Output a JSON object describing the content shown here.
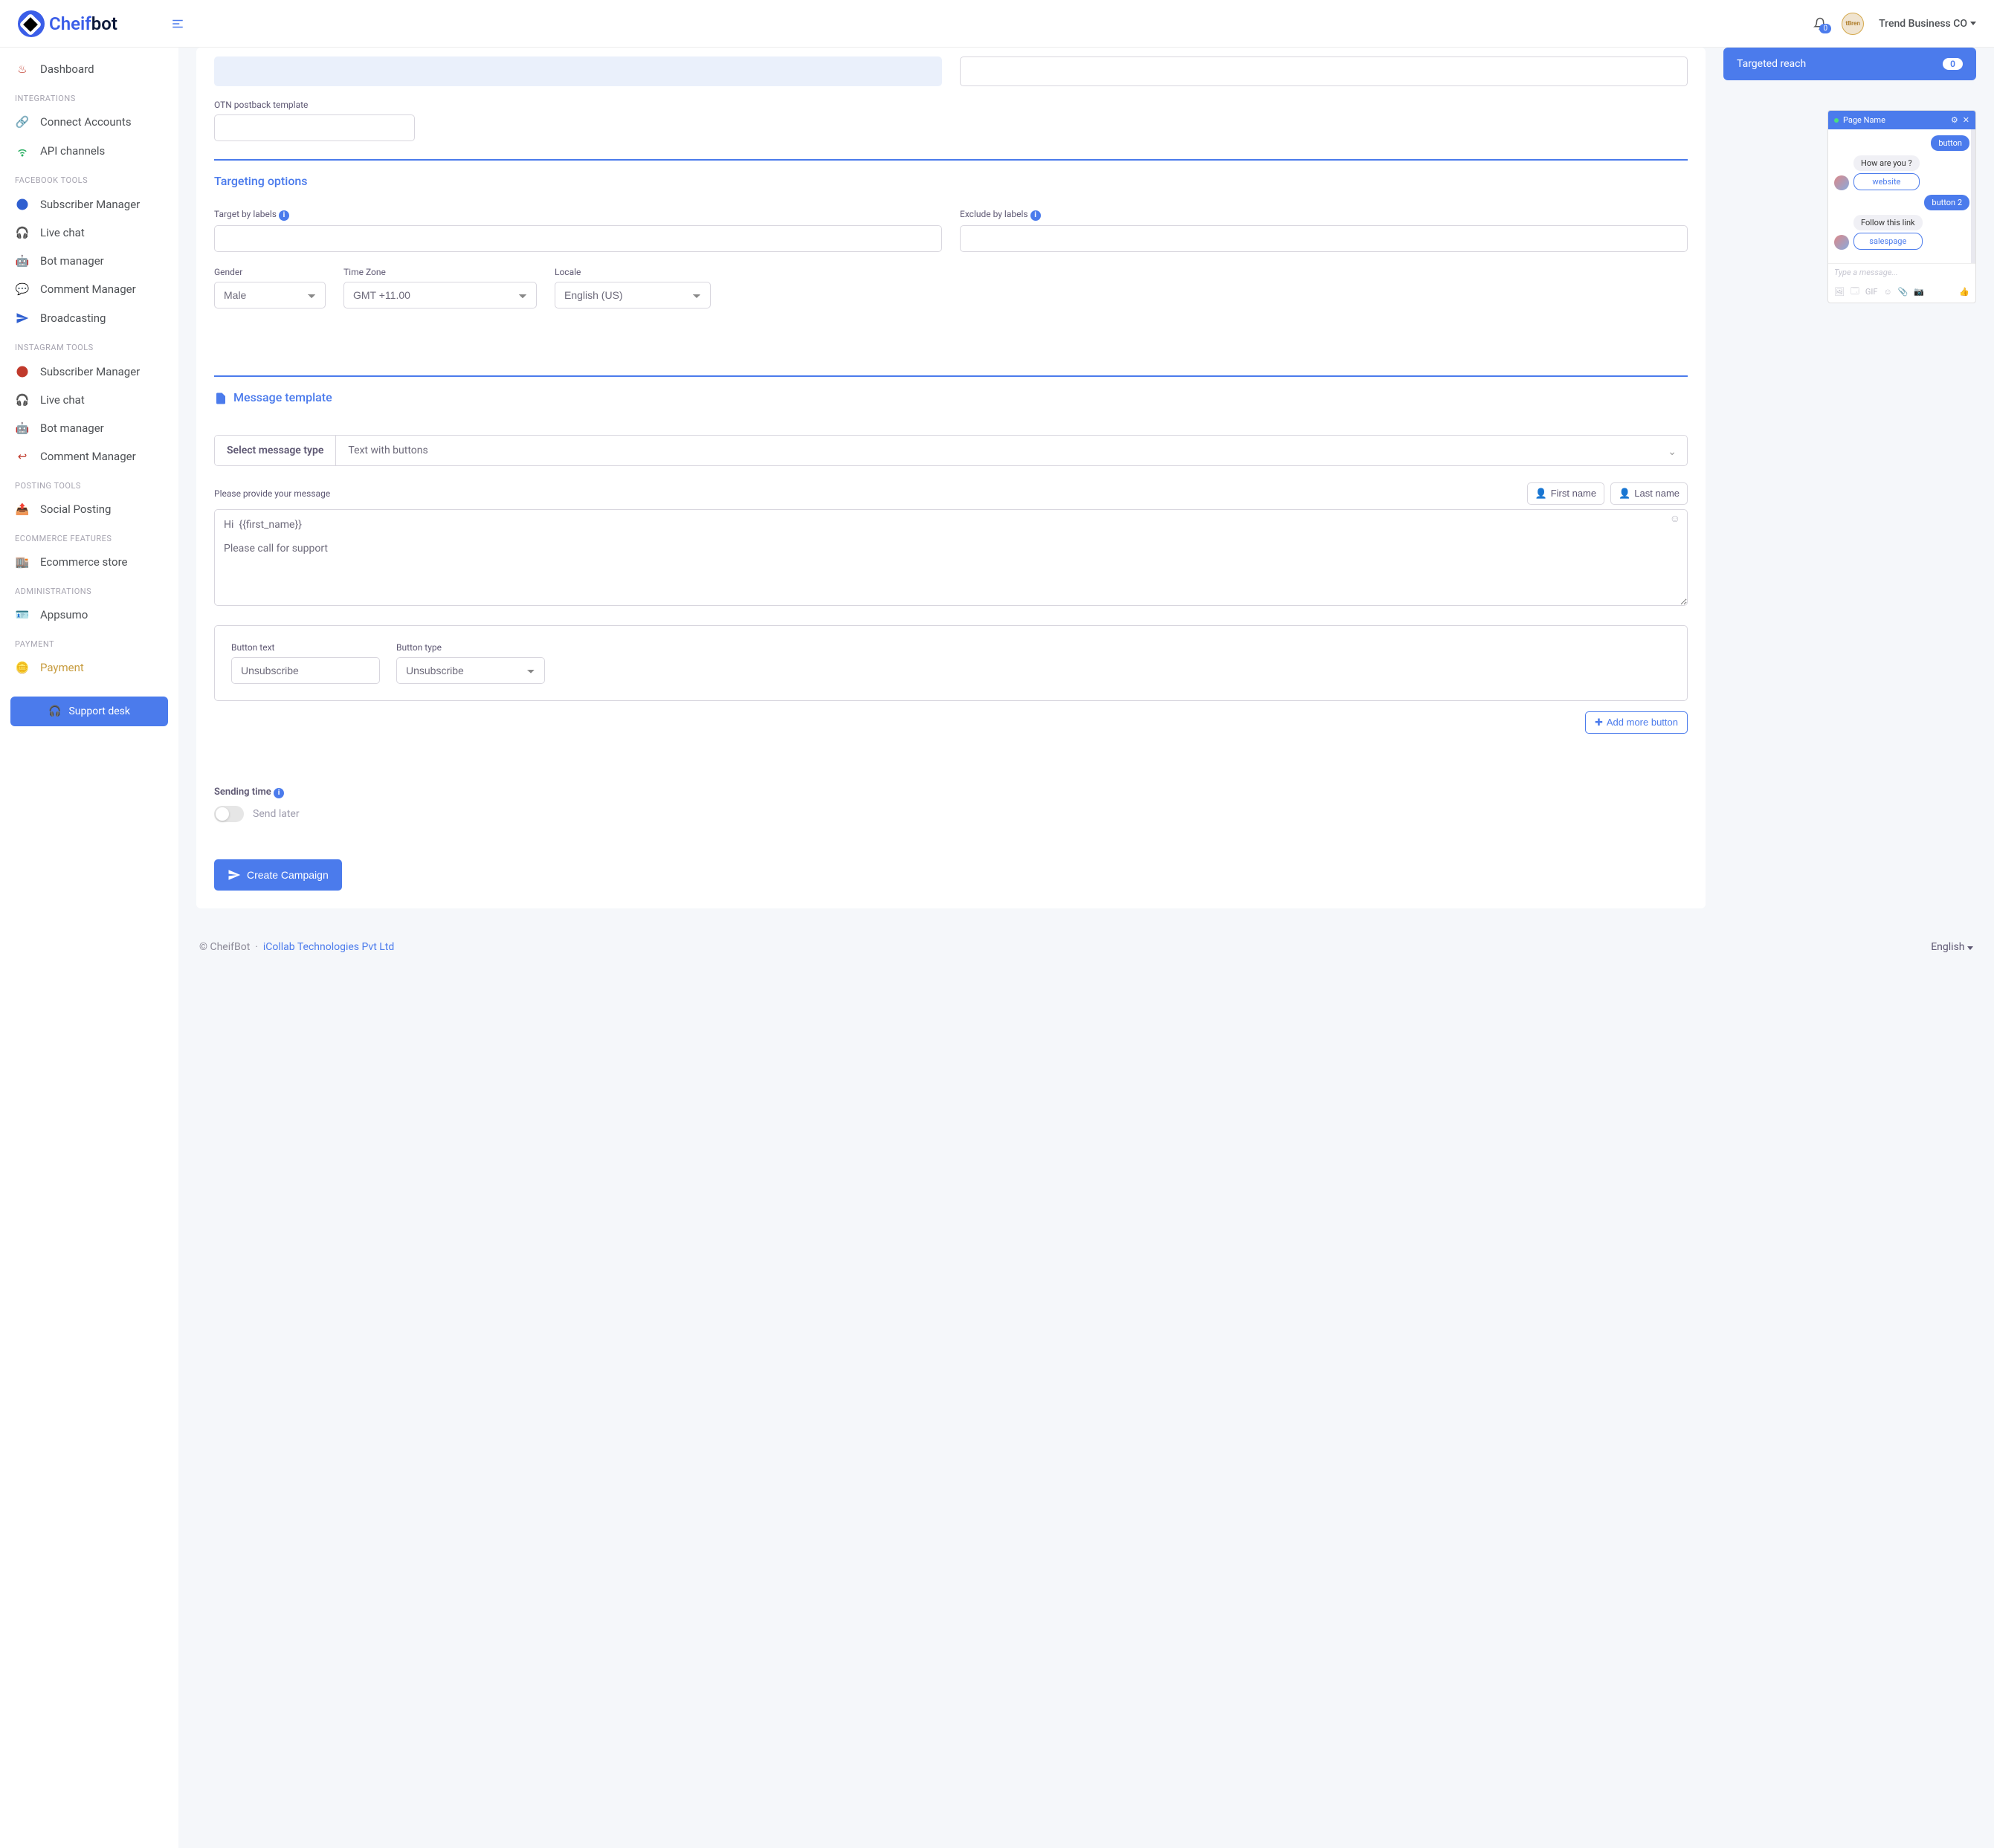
{
  "brand": {
    "name_a": "Cheif",
    "name_b": "bot"
  },
  "header": {
    "notif_count": "0",
    "company": "Trend Business CO"
  },
  "sidebar": {
    "top": {
      "dashboard": "Dashboard"
    },
    "sections": {
      "integrations": {
        "title": "INTEGRATIONS",
        "connect": "Connect Accounts",
        "api": "API channels"
      },
      "facebook": {
        "title": "FACEBOOK TOOLS",
        "sub": "Subscriber Manager",
        "live": "Live chat",
        "bot": "Bot manager",
        "comment": "Comment Manager",
        "broadcast": "Broadcasting"
      },
      "instagram": {
        "title": "INSTAGRAM TOOLS",
        "sub": "Subscriber Manager",
        "live": "Live chat",
        "bot": "Bot manager",
        "comment": "Comment Manager"
      },
      "posting": {
        "title": "POSTING TOOLS",
        "social": "Social Posting"
      },
      "ecom": {
        "title": "ECOMMERCE FEATURES",
        "store": "Ecommerce store"
      },
      "admin": {
        "title": "ADMINISTRATIONS",
        "appsumo": "Appsumo"
      },
      "payment": {
        "title": "PAYMENT",
        "payment": "Payment"
      }
    },
    "support": "Support desk"
  },
  "form": {
    "otn_label": "OTN postback template",
    "targeting_title": "Targeting options",
    "target_by": "Target by labels",
    "exclude_by": "Exclude by labels",
    "gender": {
      "label": "Gender",
      "value": "Male"
    },
    "timezone": {
      "label": "Time Zone",
      "value": "GMT +11.00"
    },
    "locale": {
      "label": "Locale",
      "value": "English (US)"
    },
    "message_title": "Message template",
    "select_label": "Select message type",
    "select_value": "Text with buttons",
    "msg_label": "Please provide your message",
    "first_name": "First name",
    "last_name": "Last name",
    "msg_text": "Hi  {{first_name}}\n\nPlease call for support",
    "btn_text_label": "Button text",
    "btn_text_value": "Unsubscribe",
    "btn_type_label": "Button type",
    "btn_type_value": "Unsubscribe",
    "add_more": "Add more button",
    "sending_time": "Sending time",
    "send_later": "Send later",
    "create": "Create Campaign"
  },
  "right": {
    "reach_label": "Targeted reach",
    "reach_value": "0",
    "preview": {
      "page_name": "Page Name",
      "btn1": "button",
      "q1": "How are you ?",
      "link1": "website",
      "btn2": "button 2",
      "q2": "Follow this link",
      "link2": "salespage",
      "placeholder": "Type a message..."
    }
  },
  "footer": {
    "copyright": "© CheifBot",
    "dot": "·",
    "company": "iCollab Technologies Pvt Ltd",
    "lang": "English"
  }
}
